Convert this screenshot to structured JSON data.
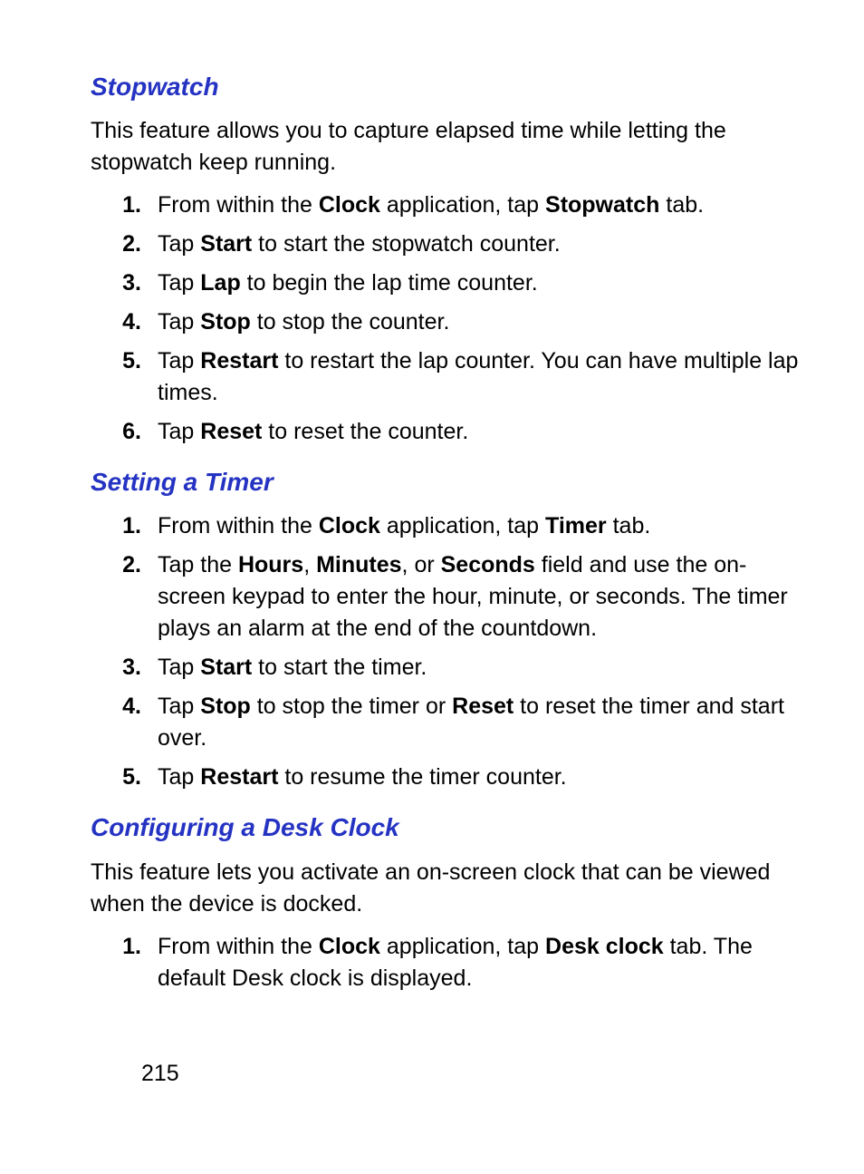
{
  "sections": [
    {
      "heading": "Stopwatch",
      "intro": "This feature allows you to capture elapsed time while letting the stopwatch keep running.",
      "steps": [
        {
          "num": "1.",
          "html": "From within the <b>Clock</b> application, tap <b>Stopwatch</b> tab."
        },
        {
          "num": "2.",
          "html": "Tap <b>Start</b> to start the stopwatch counter."
        },
        {
          "num": "3.",
          "html": "Tap <b>Lap</b> to begin the lap time counter."
        },
        {
          "num": "4.",
          "html": "Tap <b>Stop</b> to stop the counter."
        },
        {
          "num": "5.",
          "html": "Tap <b>Restart</b> to restart the lap counter. You can have multiple lap times."
        },
        {
          "num": "6.",
          "html": "Tap <b>Reset</b> to reset the counter."
        }
      ]
    },
    {
      "heading": "Setting a Timer",
      "intro": "",
      "steps": [
        {
          "num": "1.",
          "html": "From within the <b>Clock</b> application, tap <b>Timer</b> tab."
        },
        {
          "num": "2.",
          "html": "Tap the <b>Hours</b>, <b>Minutes</b>, or <b>Seconds</b> field and use the on-screen keypad to enter the hour, minute, or seconds. The timer plays an alarm at the end of the countdown."
        },
        {
          "num": "3.",
          "html": "Tap <b>Start</b> to start the timer."
        },
        {
          "num": "4.",
          "html": "Tap <b>Stop</b> to stop the timer or <b>Reset</b> to reset the timer and start over."
        },
        {
          "num": "5.",
          "html": "Tap <b>Restart</b> to resume the timer counter."
        }
      ]
    },
    {
      "heading": "Configuring a Desk Clock",
      "intro": "This feature lets you activate an on-screen clock that can be viewed when the device is docked.",
      "steps": [
        {
          "num": "1.",
          "html": "From within the <b>Clock</b> application, tap <b>Desk clock</b> tab. The default Desk clock is displayed."
        }
      ]
    }
  ],
  "page_number": "215"
}
